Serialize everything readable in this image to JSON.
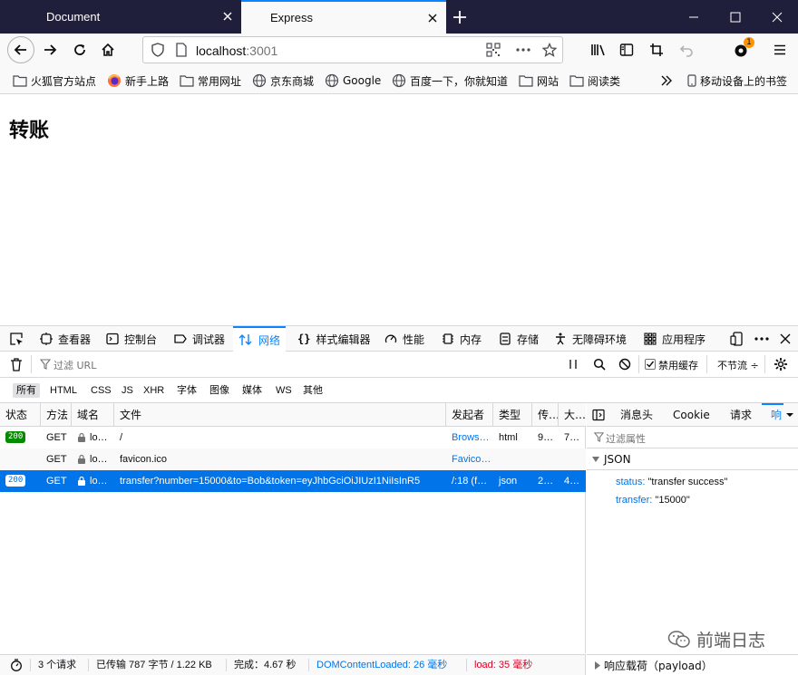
{
  "browser": {
    "tabs": [
      {
        "title": "Document",
        "active": false
      },
      {
        "title": "Express",
        "active": true
      }
    ],
    "url": {
      "host": "localhost",
      "port": ":3001"
    },
    "notification_count": "1",
    "bookmarks": [
      {
        "label": "火狐官方站点",
        "icon": "folder-icon"
      },
      {
        "label": "新手上路",
        "icon": "firefox-icon"
      },
      {
        "label": "常用网址",
        "icon": "folder-icon"
      },
      {
        "label": "京东商城",
        "icon": "globe-icon"
      },
      {
        "label": "Google",
        "icon": "globe-icon"
      },
      {
        "label": "百度一下，你就知道",
        "icon": "globe-icon"
      },
      {
        "label": "网站",
        "icon": "folder-icon"
      },
      {
        "label": "阅读类",
        "icon": "folder-icon"
      }
    ],
    "mobile_bookmarks": "移动设备上的书签"
  },
  "page": {
    "title": "转账"
  },
  "devtools": {
    "tabs": [
      "查看器",
      "控制台",
      "调试器",
      "网络",
      "样式编辑器",
      "性能",
      "内存",
      "存储",
      "无障碍环境",
      "应用程序"
    ],
    "active_tab": "网络",
    "filter_url_placeholder": "过滤 URL",
    "disable_cache_label": "禁用缓存",
    "throttle_label": "不节流",
    "throttle_arrow": "÷",
    "type_filters": [
      "所有",
      "HTML",
      "CSS",
      "JS",
      "XHR",
      "字体",
      "图像",
      "媒体",
      "WS",
      "其他"
    ],
    "columns": [
      "状态",
      "方法",
      "域名",
      "文件",
      "发起者",
      "类型",
      "传…",
      "大…"
    ],
    "requests": [
      {
        "status": "200",
        "method": "GET",
        "domain": "lo…",
        "file": "/",
        "initiator": "Brows…",
        "type": "html",
        "transferred": "9…",
        "size": "7…"
      },
      {
        "status": "",
        "method": "GET",
        "domain": "lo…",
        "file": "favicon.ico",
        "initiator": "Favico…",
        "type": "",
        "transferred": "",
        "size": ""
      },
      {
        "status": "200",
        "method": "GET",
        "domain": "lo…",
        "file": "transfer?number=15000&to=Bob&token=eyJhbGciOiJIUzI1NiIsInR5",
        "initiator": "/:18 (f…",
        "type": "json",
        "transferred": "2…",
        "size": "4…"
      }
    ],
    "side_tabs": [
      "消息头",
      "Cookie",
      "请求",
      "响"
    ],
    "filter_props_placeholder": "过滤属性",
    "json_label": "JSON",
    "json": [
      {
        "key": "status",
        "value": "\"transfer success\""
      },
      {
        "key": "transfer",
        "value": "\"15000\""
      }
    ],
    "status_bar": {
      "requests": "3 个请求",
      "transferred": "已传输 787 字节 / 1.22 KB",
      "finish": "完成：4.67 秒",
      "dom_loaded": "DOMContentLoaded: 26 毫秒",
      "load": "load: 35 毫秒"
    },
    "payload_label": "响应载荷（payload）"
  },
  "watermark": "前端日志",
  "colors": {
    "accent": "#0a84ff",
    "selected_row": "#0074e8",
    "status_ok": "#058b00",
    "load": "#d70022",
    "titlebar": "#1f1f3c"
  }
}
